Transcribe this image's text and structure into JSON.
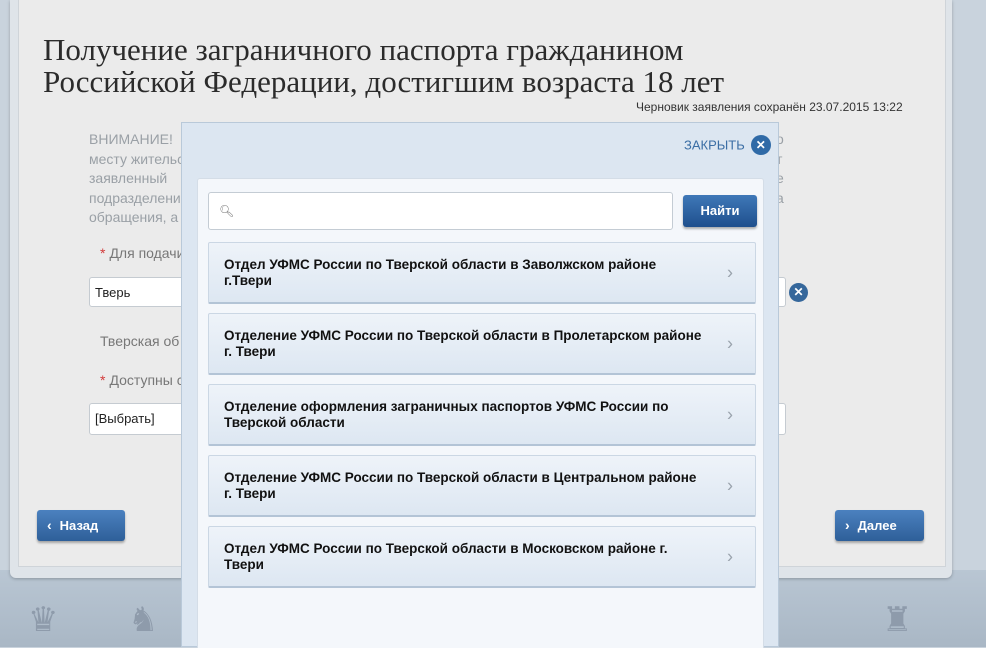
{
  "page": {
    "title": "Получение заграничного паспорта гражданином Российской Федерации, достигшим возраста 18 лет",
    "draft_status": "Черновик заявления сохранён 23.07.2015 13:22"
  },
  "form": {
    "warning_lines": [
      "ВНИМАНИЕ!",
      "месту жительс",
      "заявленный",
      "подразделени",
      "обращения, а"
    ],
    "warning_right": [
      "о",
      "т",
      "е",
      "а"
    ],
    "submit_label": "Для подачи",
    "city_value": "Тверь",
    "region_text": "Тверская об",
    "available_label": "Доступны с",
    "select_value": "[Выбрать]",
    "required_mark": "*",
    "back_button": "Назад",
    "next_button": "Далее"
  },
  "modal": {
    "close_label": "ЗАКРЫТЬ",
    "search_placeholder": "",
    "search_button": "Найти",
    "items": [
      {
        "label": "Отдел УФМС России по Тверской области в Заволжском районе г.Твери"
      },
      {
        "label": "Отделение УФМС России по Тверской области в Пролетарском районе г. Твери"
      },
      {
        "label": "Отделение оформления заграничных паспортов УФМС России по Тверской области"
      },
      {
        "label": "Отделение УФМС России по Тверской области в Центральном районе г. Твери"
      },
      {
        "label": "Отдел УФМС России по Тверской области в Московском районе г. Твери"
      }
    ]
  },
  "icons": {
    "search": "search-icon",
    "close": "close-icon",
    "chevron": "chevron-right-icon",
    "back": "chevron-left-icon",
    "next": "chevron-right-icon"
  },
  "colors": {
    "accent": "#2f6aa7",
    "button": "#2e5f99",
    "required": "#d23a3a"
  }
}
